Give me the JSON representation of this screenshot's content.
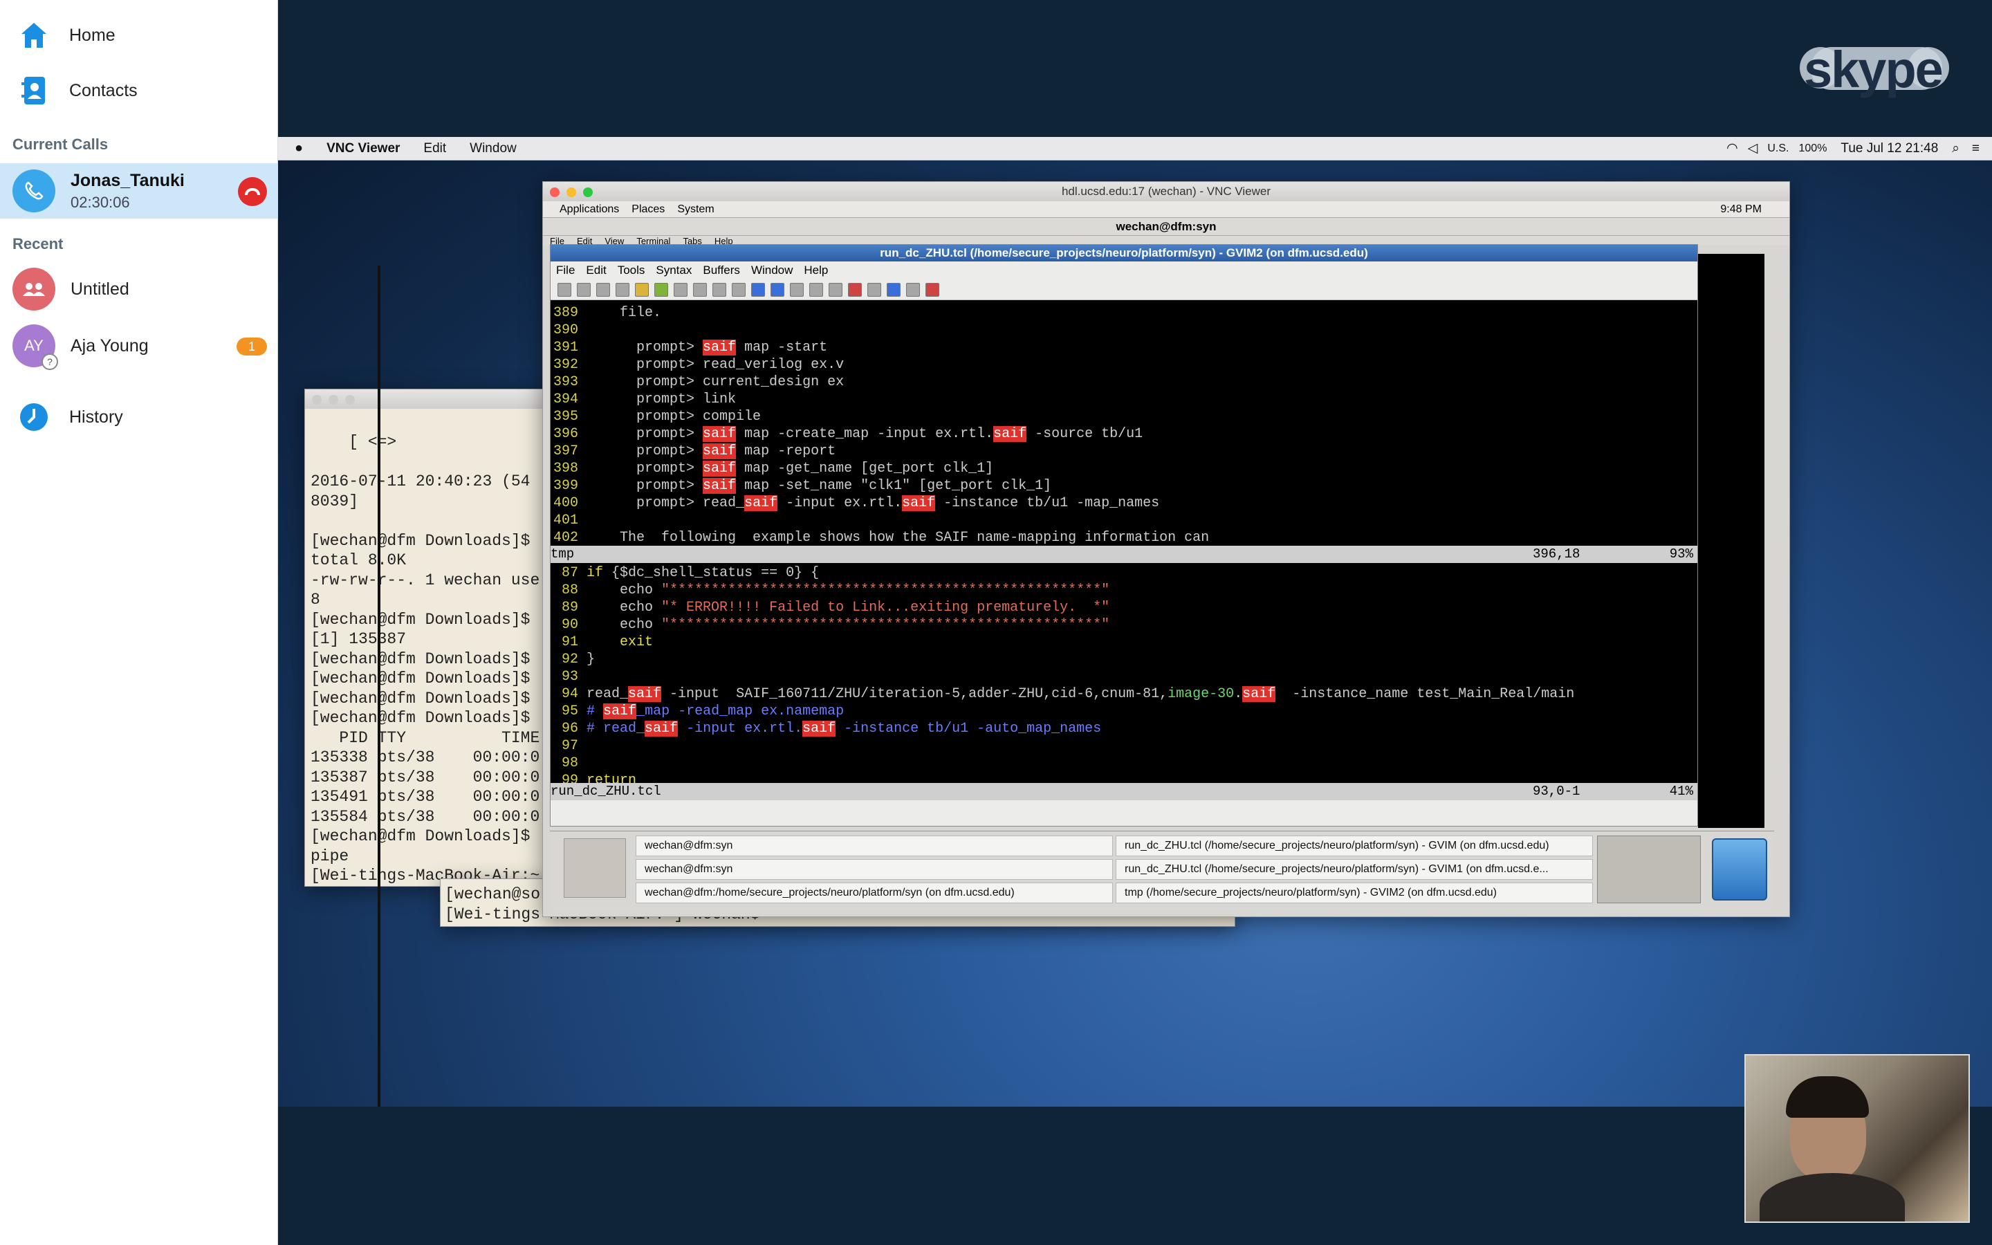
{
  "skype": {
    "nav": [
      {
        "label": "Home",
        "icon": "home-icon"
      },
      {
        "label": "Contacts",
        "icon": "contacts-icon"
      }
    ],
    "current_calls_header": "Current Calls",
    "call": {
      "name": "Jonas_Tanuki",
      "duration": "02:30:06"
    },
    "recent_header": "Recent",
    "recent": [
      {
        "name": "Untitled",
        "initials": ""
      },
      {
        "name": "Aja Young",
        "initials": "AY",
        "badge": "1"
      }
    ],
    "history": "History",
    "logo": "skype"
  },
  "macbar": {
    "app": "VNC Viewer",
    "menus": [
      "Edit",
      "Window"
    ],
    "locale": "U.S.",
    "battery": "100%",
    "clock": "Tue Jul 12  21:48"
  },
  "vnc": {
    "title": "hdl.ucsd.edu:17 (wechan) - VNC Viewer",
    "gnome_menus": [
      "Applications",
      "Places",
      "System"
    ],
    "gnome_clock": "9:48 PM",
    "term_title": "wechan@dfm:syn",
    "term_menus": [
      "File",
      "Edit",
      "View",
      "Terminal",
      "Tabs",
      "Help"
    ],
    "gvim_title": "run_dc_ZHU.tcl (/home/secure_projects/neuro/platform/syn) - GVIM2 (on dfm.ucsd.edu)",
    "gvim_menus": [
      "File",
      "Edit",
      "Tools",
      "Syntax",
      "Buffers",
      "Window",
      "Help"
    ],
    "top_status_name": "tmp",
    "top_status_pos": "396,18",
    "top_status_pct": "93%",
    "bottom_status_name": "run_dc_ZHU.tcl",
    "bottom_status_pos": "93,0-1",
    "bottom_status_pct": "41%",
    "tasks_left": [
      "wechan@dfm:syn",
      "wechan@dfm:syn",
      "wechan@dfm:/home/secure_projects/neuro/platform/syn (on dfm.ucsd.edu)"
    ],
    "tasks_right": [
      "run_dc_ZHU.tcl (/home/secure_projects/neuro/platform/syn) - GVIM (on dfm.ucsd.edu)",
      "run_dc_ZHU.tcl (/home/secure_projects/neuro/platform/syn) - GVIM1 (on dfm.ucsd.e...",
      "tmp (/home/secure_projects/neuro/platform/syn) - GVIM2 (on dfm.ucsd.edu)"
    ]
  },
  "terminal": {
    "lines": [
      "    [ <=>",
      "",
      "2016-07-11 20:40:23 (54",
      "8039]",
      "",
      "[wechan@dfm Downloads]$",
      "total 8.0K",
      "-rw-rw-r--. 1 wechan use",
      "8",
      "[wechan@dfm Downloads]$",
      "[1] 135387",
      "[wechan@dfm Downloads]$",
      "[wechan@dfm Downloads]$",
      "[wechan@dfm Downloads]$",
      "[wechan@dfm Downloads]$",
      "   PID TTY          TIME",
      "135338 pts/38    00:00:0",
      "135387 pts/38    00:00:0",
      "135491 pts/38    00:00:0",
      "135584 pts/38    00:00:0",
      "[wechan@dfm Downloads]$",
      "pipe",
      "[Wei-tings-MacBook-Air:~"
    ]
  },
  "terminal2": {
    "lines": [
      "[wechan@so",
      "[Wei-tings-MacBook-Air:~] wechan$"
    ]
  }
}
